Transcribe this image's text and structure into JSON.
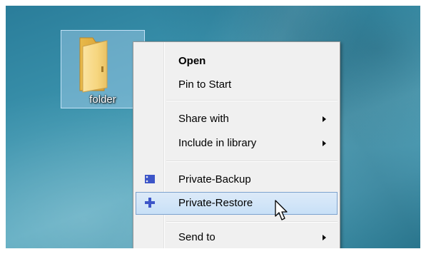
{
  "desktop": {
    "folder": {
      "label": "folder",
      "icon": "folder-icon"
    }
  },
  "context_menu": {
    "items": [
      {
        "label": "Open",
        "bold": true
      },
      {
        "label": "Pin to Start"
      },
      {
        "label": "Share with",
        "submenu": true
      },
      {
        "label": "Include in library",
        "submenu": true
      },
      {
        "label": "Private-Backup",
        "icon": "backup-icon"
      },
      {
        "label": "Private-Restore",
        "icon": "restore-icon",
        "highlighted": true
      },
      {
        "label": "Send to",
        "submenu": true
      }
    ]
  },
  "colors": {
    "highlight_border": "#7da2ce",
    "highlight_fill": "#c8e0f7",
    "menu_bg": "#f0f0f0",
    "icon_blue": "#3c55c8"
  },
  "cursor": {
    "icon": "arrow-cursor-icon"
  }
}
